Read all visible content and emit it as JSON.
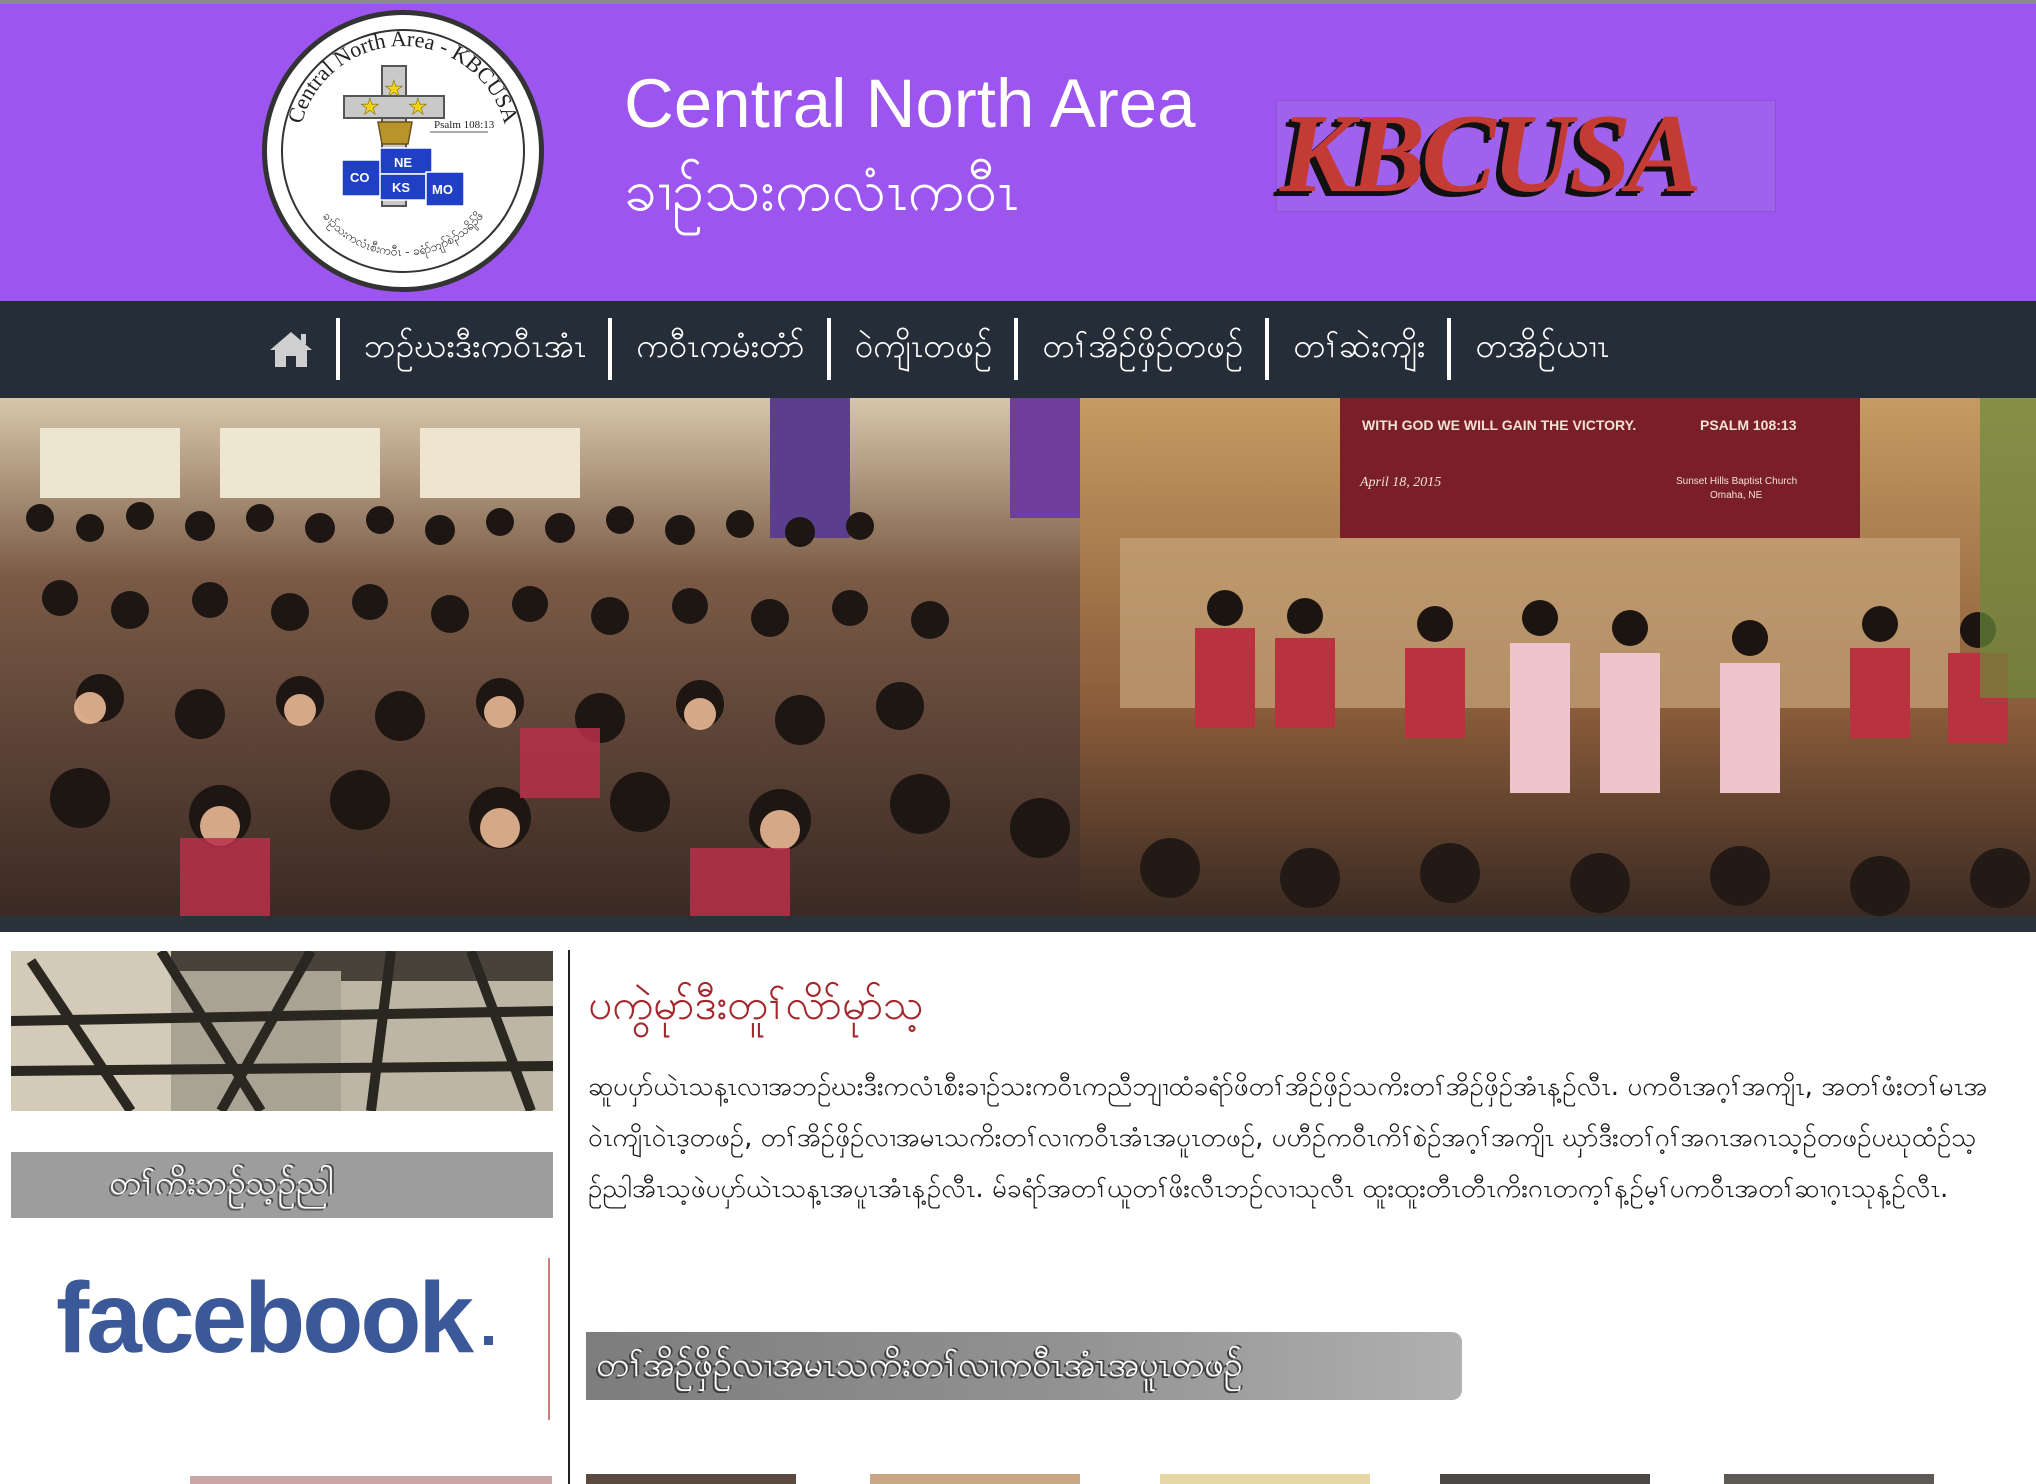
{
  "header": {
    "title_line1": "Central North Area",
    "title_line2": "ခၢဉ်သးကလံၤကဝီၤ",
    "brand_logo_text": "KBCUSA",
    "seal": {
      "ring_text_top": "Central North Area - KBCUSA",
      "ring_text_bottom": "ခၢဉ်သးကလံၤစီးကဝီၤ - ခရံာ်ဘျာ်စဲၣ်သရိၣ်ဖိ",
      "verse": "Psalm 108:13",
      "states": [
        "NE",
        "CO",
        "KS",
        "MO"
      ]
    }
  },
  "nav": {
    "home_icon": "home-icon",
    "items": [
      {
        "label": "ဘဉ်ဃးဒီးကဝီၤအံၤ"
      },
      {
        "label": "ကဝီၤကမံးတံာ်"
      },
      {
        "label": "ဝဲကျိၤတဖဉ်"
      },
      {
        "label": "တၢ်အိဉ်ဖှိဉ်တဖဉ်"
      },
      {
        "label": "တၢ်ဆဲးကျိး"
      },
      {
        "label": "တအိဉ်ယၢၤ"
      }
    ]
  },
  "hero": {
    "banner_line1": "WITH GOD WE WILL GAIN THE VICTORY.",
    "banner_verse": "PSALM 108:13",
    "banner_date": "April 18, 2015",
    "banner_church_1": "Sunset Hills Baptist Church",
    "banner_church_2": "Omaha, NE"
  },
  "sidebar": {
    "contact_label": "တၢ်ကိးဘဉ်သ့ဉ်ညါ",
    "facebook_label": "facebook"
  },
  "main": {
    "title": "ပကွဲမုာ်ဒီးတူၢ်လိာ်မုာ်သ့",
    "paragraph": "ဆူပပှာ်ယဲၤသန့ၤလၢအဘဉ်ဃးဒီးကလံၤစီးခၢဉ်သးကဝီၤကညီဘျၢထံခရံာ်ဖိတၢ်အိဉ်ဖှိဉ်သကိးတၢ်အိဉ်ဖှိဉ်အံၤန့ဉ်လီၤ. ပကဝီၤအဂ့ၢ်အကျိၤ, အတၢ်ဖံးတၢ်မၤအဝဲၤကျိၤဝဲၤဒ့တဖဉ်, တၢ်အိဉ်ဖှိဉ်လၢအမၤသကိးတၢ်လၢကဝီၤအံၤအပူၤတဖဉ်, ပဟီဉ်ကဝီၤကိၢ်စဲဉ်အဂ့ၢ်အကျိၤ ဃှာ်ဒီးတၢ်ဂ့ၢ်အဂၤအဂၤသ့ဉ်တဖဉ်ပဃုထံဉ်သ့ဉ်ညါအီၤသ့ဖဲပပှာ်ယဲၤသန့ၤအပူၤအံၤန့ဉ်လီၤ. မ်ခရံာ်အတၢ်ယူတၢ်ဖိးလီၤဘဉ်လၢသုလီၤ ထူးထူးတီၤတီၤကိးဂၤတက့ၢ်န့ဉ်မ့ၢ်ပကဝီၤအတၢ်ဆၢဂ့ၤသုန့ဉ်လီၤ.",
    "section_banner": "တၢ်အိဉ်ဖှိဉ်လၢအမၤသကိးတၢ်လၢကဝီၤအံၤအပူၤတဖဉ်"
  },
  "colors": {
    "header_bg": "#9c55ee",
    "nav_bg": "#242d38",
    "title_red": "#a2282d",
    "kbcusa_red": "#c43a34",
    "facebook_blue": "#3b5998"
  }
}
